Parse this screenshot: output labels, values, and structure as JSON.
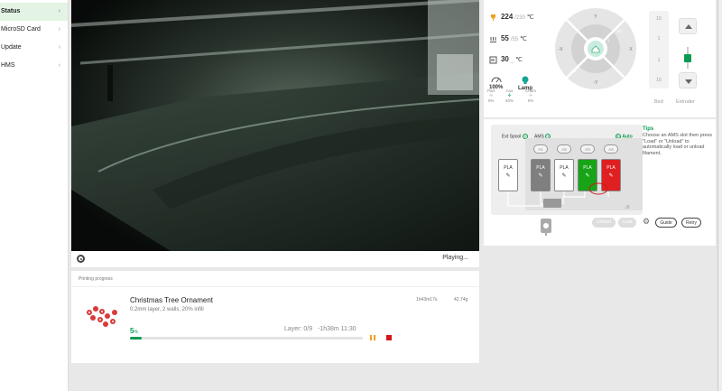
{
  "sidebar": {
    "items": [
      {
        "label": "Status",
        "active": true
      },
      {
        "label": "MicroSD Card"
      },
      {
        "label": "Update"
      },
      {
        "label": "HMS"
      }
    ]
  },
  "video": {
    "status": "Playing..."
  },
  "progress": {
    "section_title": "Printing progress",
    "job_name": "Christmas Tree Ornament",
    "job_details": "0.2mm layer, 2 walls, 20% infill",
    "time": "1h43m17s",
    "weight": "42.74g",
    "percent": "5",
    "percent_symbol": "%",
    "layer": "Layer: 0/9",
    "remaining": "-1h38m  11:30",
    "progress_fraction": 0.05
  },
  "temps": {
    "nozzle": "224",
    "nozzle_target": "/230",
    "bed": "55",
    "bed_target": "/55",
    "chamber": "30",
    "chamber_target": "_",
    "unit": "℃"
  },
  "fans": {
    "speed": "100%",
    "lamp": "Lamp",
    "part_label": "Part",
    "aux_label": "Aux",
    "chamber_label": "Cham",
    "part": "0%",
    "aux": "40%",
    "chamber": "0%"
  },
  "jog": {
    "y_plus": "Y",
    "y_minus": "-Y",
    "x_plus": "X",
    "x_minus": "-X",
    "ten_plus": "10",
    "one_plus": "1",
    "one_minus": "-1",
    "ten_minus": "-10"
  },
  "z": {
    "up10": "10",
    "up1": "1",
    "down1": "1",
    "down10": "10"
  },
  "labels": {
    "bed": "Bed",
    "extruder": "Extruder"
  },
  "ams": {
    "ext_spool": "Ext Spool",
    "ams": "AMS",
    "auto_refill": "Auto Refill",
    "slot_labels": [
      "A1",
      "A2",
      "A3",
      "A4"
    ],
    "ext_slot_label": "PLA",
    "slots": [
      {
        "label": "PLA",
        "color": "#7f7f7f"
      },
      {
        "label": "PLA",
        "color": "#ffffff"
      },
      {
        "label": "PLA",
        "color": "#17a417"
      },
      {
        "label": "PLA",
        "color": "#e02020"
      }
    ],
    "unload": "Unload",
    "load": "Load",
    "guide": "Guide",
    "retry": "Retry"
  },
  "tips": {
    "title": "Tips",
    "text": "Choose an AMS slot then press \"Load\" or \"Unload\" to automatically load or unload filament."
  }
}
